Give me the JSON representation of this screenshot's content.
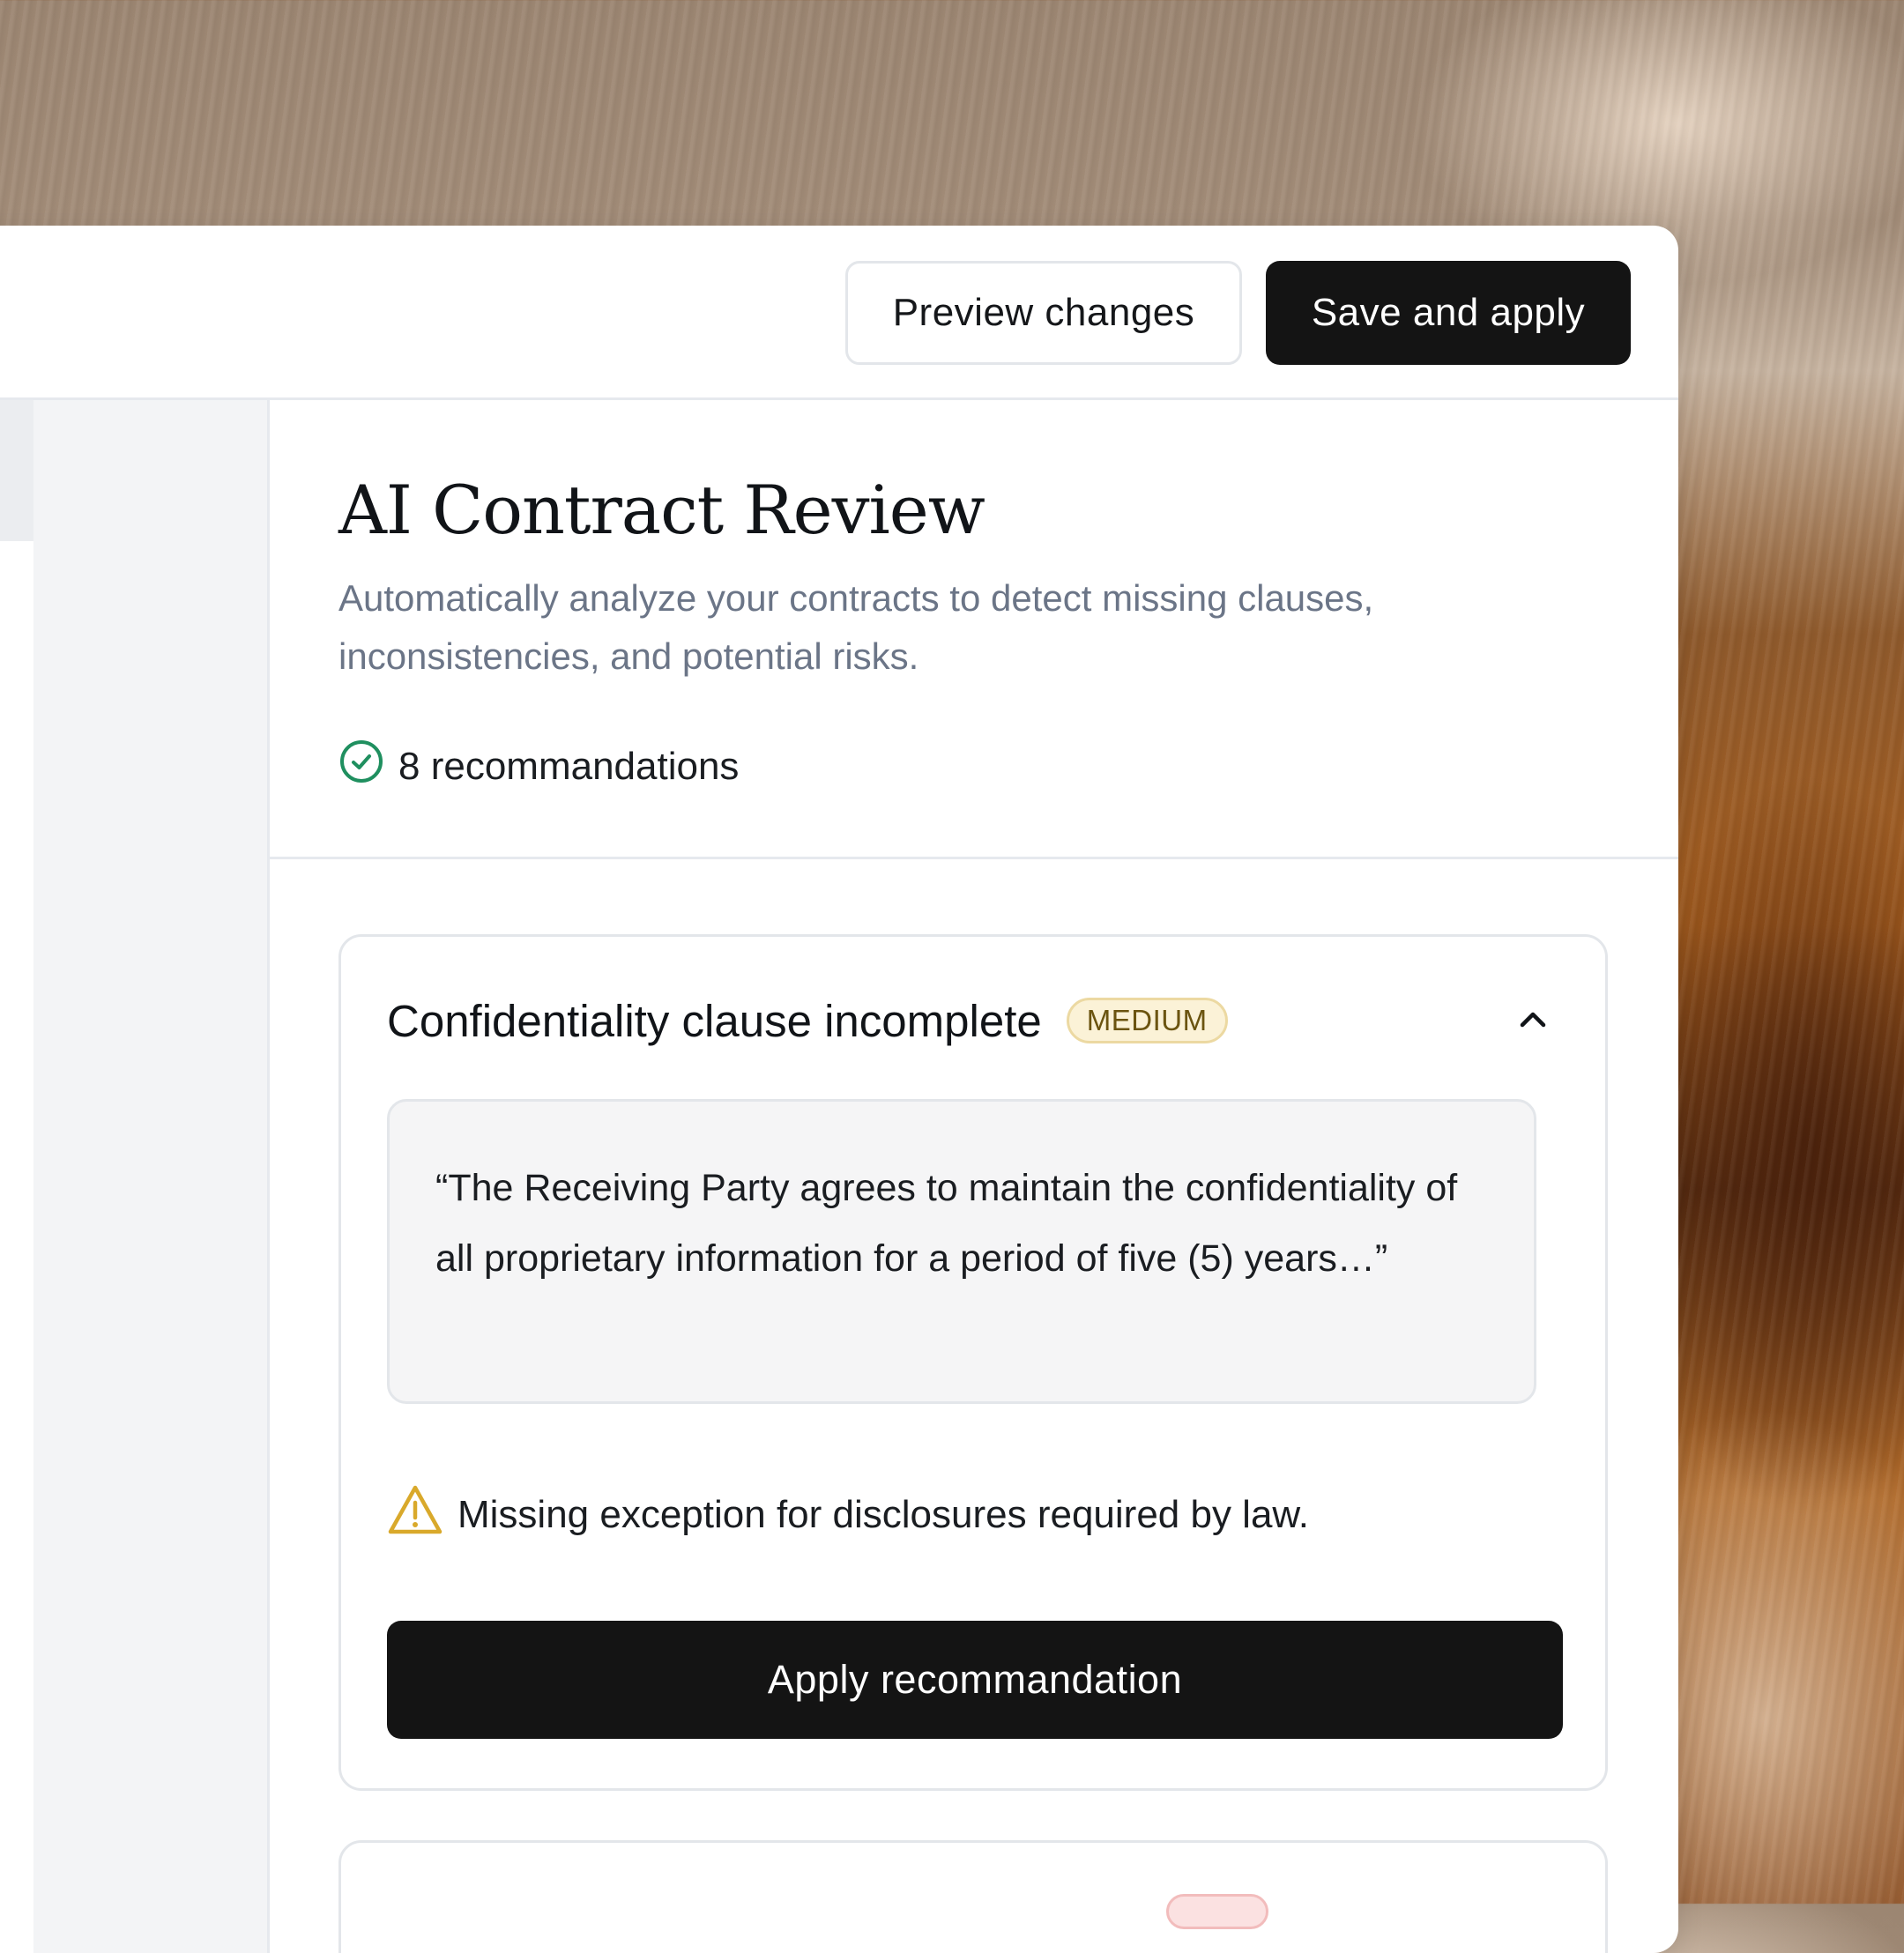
{
  "toolbar": {
    "preview_label": "Preview changes",
    "save_label": "Save and apply"
  },
  "header": {
    "title": "AI Contract Review",
    "description": "Automatically analyze your contracts to detect missing clauses, inconsistencies, and potential risks.",
    "recommendations_count": "8 recommandations",
    "count_icon": "check-circle-icon"
  },
  "recommendation_card": {
    "title": "Confidentiality clause incomplete",
    "severity": "MEDIUM",
    "expanded_icon": "chevron-up-icon",
    "quote": "“The Receiving Party agrees to maintain the confidentiality of all proprietary information for a period of five (5) years…”",
    "warning_icon": "warning-triangle-icon",
    "warning_text": "Missing exception for disclosures required by law.",
    "apply_label": "Apply recommandation"
  },
  "colors": {
    "primary_button": "#141414",
    "success": "#1f8f5f",
    "warning": "#d9a92b",
    "badge_medium_bg": "#fbf2d7",
    "badge_high_bg": "#fbe1e1"
  }
}
